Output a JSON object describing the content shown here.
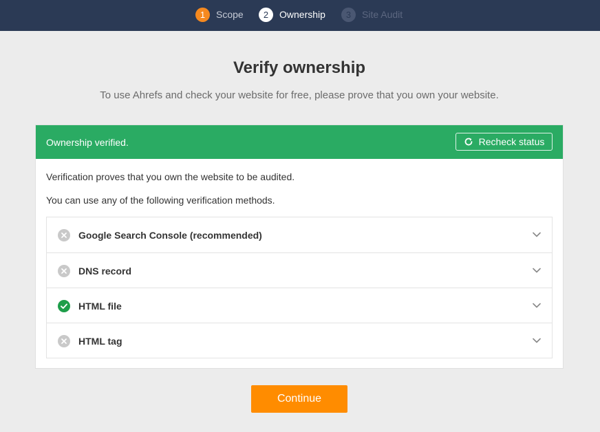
{
  "steps": [
    {
      "number": "1",
      "label": "Scope"
    },
    {
      "number": "2",
      "label": "Ownership"
    },
    {
      "number": "3",
      "label": "Site Audit"
    }
  ],
  "page": {
    "title": "Verify ownership",
    "subtitle": "To use Ahrefs and check your website for free, please prove that you own your website."
  },
  "banner": {
    "status_text": "Ownership verified.",
    "recheck_label": "Recheck status",
    "recheck_icon": "refresh-icon",
    "color": "#2aab63"
  },
  "card": {
    "description": "Verification proves that you own the website to be audited.",
    "methods_intro": "You can use any of the following verification methods."
  },
  "methods": [
    {
      "label": "Google Search Console (recommended)",
      "status": "unverified"
    },
    {
      "label": "DNS record",
      "status": "unverified"
    },
    {
      "label": "HTML file",
      "status": "verified"
    },
    {
      "label": "HTML tag",
      "status": "unverified"
    }
  ],
  "actions": {
    "continue_label": "Continue",
    "accent_color": "#ff8c00"
  }
}
